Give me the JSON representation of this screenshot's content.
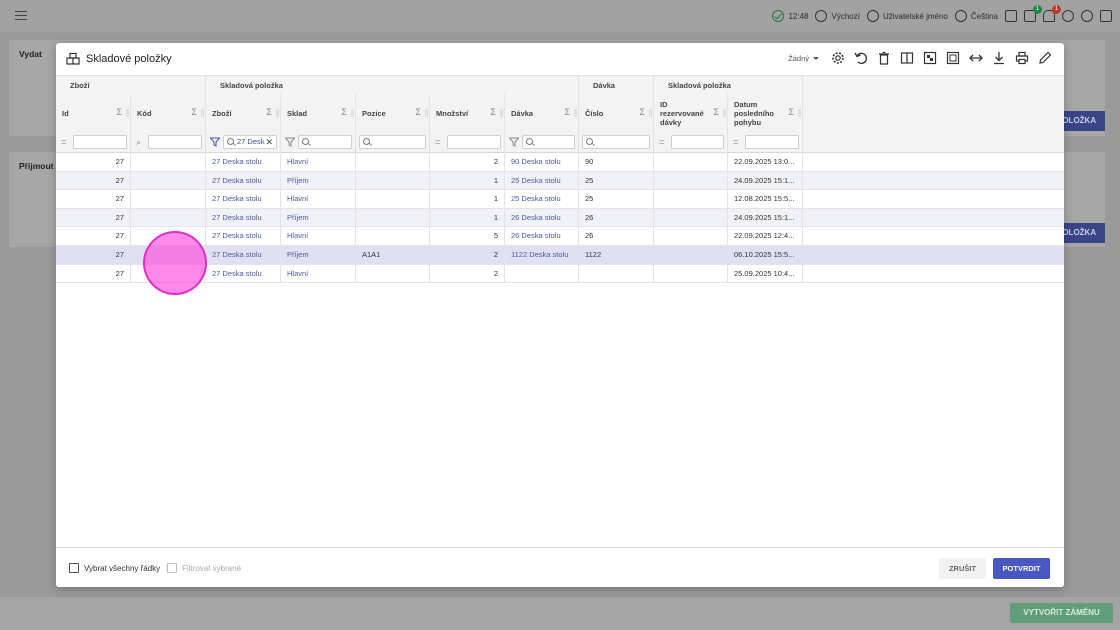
{
  "topbar": {
    "time": "12:48",
    "mode": "Výchozí",
    "username": "Uživatelské jméno",
    "language": "Čeština",
    "badge_green": "1",
    "badge_red": "1"
  },
  "background": {
    "panel1_label": "Vydat",
    "panel2_label": "Přijmout",
    "add_item_label": "POLOŽKA",
    "create_change_label": "VYTVOŘIT ZÁMĚNU"
  },
  "modal": {
    "title": "Skladové položky",
    "select_value": "Žádný",
    "groups": [
      "Zboží",
      "Skladová položka",
      "Dávka",
      "Skladová položka"
    ],
    "columns": [
      {
        "label": "Id"
      },
      {
        "label": "Kód"
      },
      {
        "label": "Zboží"
      },
      {
        "label": "Sklad"
      },
      {
        "label": "Pozice"
      },
      {
        "label": "Množství"
      },
      {
        "label": "Dávka"
      },
      {
        "label": "Číslo"
      },
      {
        "label": "ID rezervované dávky"
      },
      {
        "label": "Datum posledního pohybu"
      }
    ],
    "filters": {
      "zbozi_value": "27 Desk"
    },
    "rows": [
      {
        "id": "27",
        "kod": "",
        "zbozi": "27 Deska stolu",
        "sklad": "Hlavní",
        "pozice": "",
        "mnozstvi": "2",
        "davka": "90 Deska stolu",
        "cislo": "90",
        "rez": "",
        "datum": "22.09.2025 13:0..."
      },
      {
        "id": "27",
        "kod": "",
        "zbozi": "27 Deska stolu",
        "sklad": "Příjem",
        "pozice": "",
        "mnozstvi": "1",
        "davka": "25 Deska stolu",
        "cislo": "25",
        "rez": "",
        "datum": "24.09.2025 15:1..."
      },
      {
        "id": "27",
        "kod": "",
        "zbozi": "27 Deska stolu",
        "sklad": "Hlavní",
        "pozice": "",
        "mnozstvi": "1",
        "davka": "25 Deska stolu",
        "cislo": "25",
        "rez": "",
        "datum": "12.08.2025 15:5..."
      },
      {
        "id": "27",
        "kod": "",
        "zbozi": "27 Deska stolu",
        "sklad": "Příjem",
        "pozice": "",
        "mnozstvi": "1",
        "davka": "26 Deska stolu",
        "cislo": "26",
        "rez": "",
        "datum": "24.09.2025 15:1..."
      },
      {
        "id": "27",
        "kod": "",
        "zbozi": "27 Deska stolu",
        "sklad": "Hlavní",
        "pozice": "",
        "mnozstvi": "5",
        "davka": "26 Deska stolu",
        "cislo": "26",
        "rez": "",
        "datum": "22.09.2025 12:4..."
      },
      {
        "id": "27",
        "kod": "",
        "zbozi": "27 Deska stolu",
        "sklad": "Příjem",
        "pozice": "A1A1",
        "mnozstvi": "2",
        "davka": "1122 Deska stolu",
        "cislo": "1122",
        "rez": "",
        "datum": "06.10.2025 15:5..."
      },
      {
        "id": "27",
        "kod": "",
        "zbozi": "27 Deska stolu",
        "sklad": "Hlavní",
        "pozice": "",
        "mnozstvi": "2",
        "davka": "",
        "cislo": "",
        "rez": "",
        "datum": "25.09.2025 10:4..."
      }
    ],
    "selected_row": 5,
    "footer": {
      "select_all": "Vybrat všechny řádky",
      "filter_selected": "Filtrovat vybrané",
      "cancel": "ZRUŠIT",
      "confirm": "POTVRDIT"
    }
  }
}
